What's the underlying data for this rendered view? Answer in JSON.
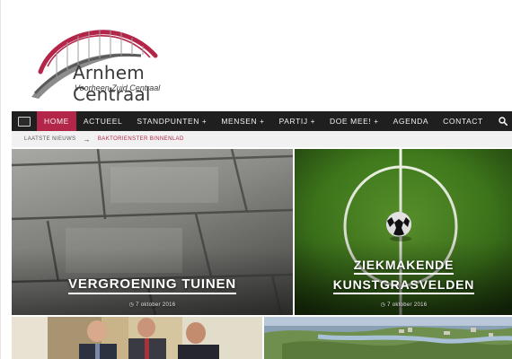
{
  "site": {
    "title": "Arnhem Centraal",
    "subtitle": "Voorheen Zuid Centraal",
    "colors": {
      "accent": "#b4254a",
      "nav_bg": "#1f1f1f",
      "ticker_bg": "#f1f1f1"
    }
  },
  "nav": {
    "home_icon": "home-icon",
    "items": [
      {
        "label": "HOME",
        "active": true
      },
      {
        "label": "ACTUEEL"
      },
      {
        "label": "STANDPUNTEN",
        "plus": "+"
      },
      {
        "label": "MENSEN",
        "plus": "+"
      },
      {
        "label": "PARTIJ",
        "plus": "+"
      },
      {
        "label": "DOE MEE!",
        "plus": "+"
      },
      {
        "label": "AGENDA"
      },
      {
        "label": "CONTACT"
      }
    ],
    "search_icon": "search-icon"
  },
  "ticker": {
    "label": "LAATSTE NIEUWS",
    "arrow": "→",
    "text": "BAKTORIENSTER BINNENLAD"
  },
  "features": [
    {
      "title": "VERGROENING TUINEN",
      "date": "7 oktober 2016"
    },
    {
      "title_line1": "ZIEKMAKENDE",
      "title_line2": "KUNSTGRASVELDEN",
      "date": "7 oktober 2016"
    }
  ]
}
